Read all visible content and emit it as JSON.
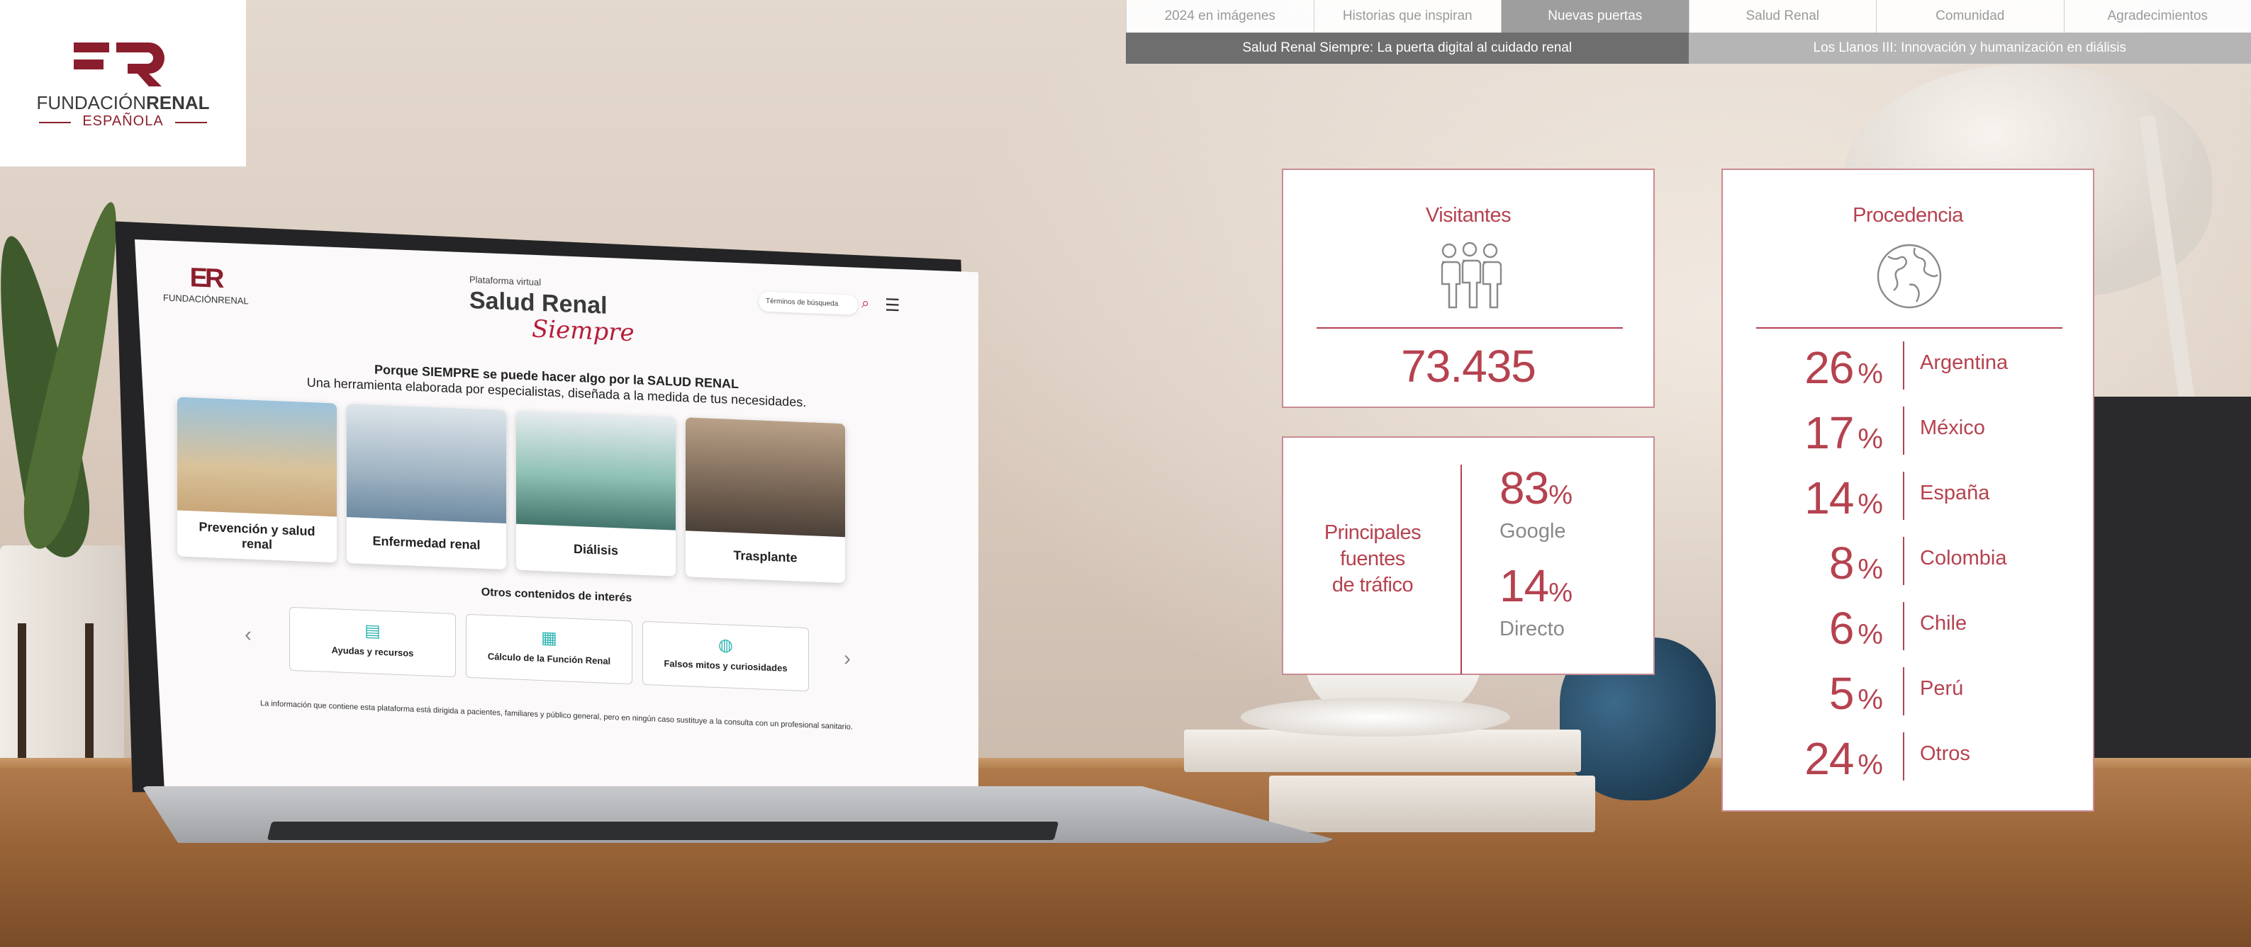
{
  "logo": {
    "word_regular": "FUNDACIÓN",
    "word_bold": "RENAL",
    "subtitle": "ESPAÑOLA"
  },
  "nav": {
    "tabs": [
      {
        "label": "2024 en imágenes",
        "active": false
      },
      {
        "label": "Historias que inspiran",
        "active": false
      },
      {
        "label": "Nuevas puertas",
        "active": true
      },
      {
        "label": "Salud Renal",
        "active": false
      },
      {
        "label": "Comunidad",
        "active": false
      },
      {
        "label": "Agradecimientos",
        "active": false
      }
    ],
    "subtabs": [
      {
        "label": "Salud Renal Siempre: La puerta digital al cuidado renal",
        "active": true
      },
      {
        "label": "Los Llanos III: Innovación y humanización en diálisis",
        "active": false
      }
    ]
  },
  "visitors": {
    "title": "Visitantes",
    "icon": "people-group-icon",
    "value": "73.435"
  },
  "traffic": {
    "label_lines": [
      "Principales",
      "fuentes",
      "de tráfico"
    ],
    "sources": [
      {
        "value": "83",
        "unit": "%",
        "name": "Google"
      },
      {
        "value": "14",
        "unit": "%",
        "name": "Directo"
      }
    ]
  },
  "origin": {
    "title": "Procedencia",
    "icon": "globe-icon",
    "rows": [
      {
        "value": "26",
        "unit": "%",
        "country": "Argentina"
      },
      {
        "value": "17",
        "unit": "%",
        "country": "México"
      },
      {
        "value": "14",
        "unit": "%",
        "country": "España"
      },
      {
        "value": "8",
        "unit": "%",
        "country": "Colombia"
      },
      {
        "value": "6",
        "unit": "%",
        "country": "Chile"
      },
      {
        "value": "5",
        "unit": "%",
        "country": "Perú"
      },
      {
        "value": "24",
        "unit": "%",
        "country": "Otros"
      }
    ]
  },
  "laptop_screen": {
    "logo_text": "FUNDACIÓNRENAL",
    "platform_small": "Plataforma virtual",
    "platform_title": "Salud Renal",
    "platform_script": "Siempre",
    "search_placeholder": "Términos de búsqueda",
    "headline": "Porque SIEMPRE se puede hacer algo por la SALUD RENAL",
    "subheadline": "Una herramienta elaborada por especialistas, diseñada a la medida de tus necesidades.",
    "cards": [
      {
        "label": "Prevención y salud renal"
      },
      {
        "label": "Enfermedad renal"
      },
      {
        "label": "Diálisis"
      },
      {
        "label": "Trasplante"
      }
    ],
    "other_title": "Otros contenidos de interés",
    "resources": [
      {
        "label": "Ayudas y recursos"
      },
      {
        "label": "Cálculo de la Función Renal"
      },
      {
        "label": "Falsos mitos y curiosidades"
      }
    ],
    "footer": "La información que contiene esta plataforma está dirigida a pacientes, familiares y público general, pero en ningún caso sustituye a la consulta con un profesional sanitario."
  },
  "colors": {
    "brand": "#b5424f",
    "brand_dark": "#8b1e2d",
    "nav_active": "#9e9e9e",
    "subnav_active": "#6e6e6e",
    "subnav_inactive": "#b5b5b5"
  }
}
